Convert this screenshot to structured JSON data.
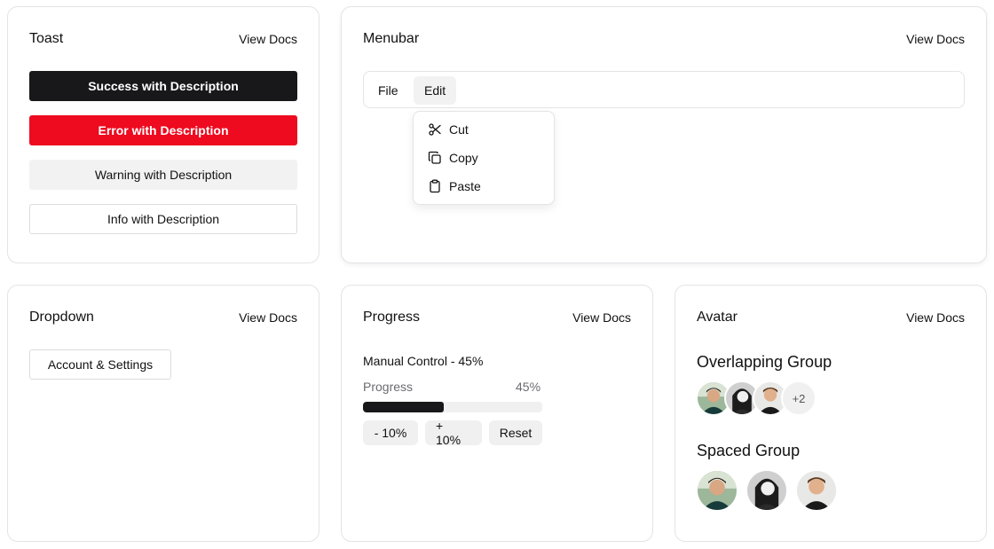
{
  "common": {
    "view_docs": "View Docs"
  },
  "toast": {
    "title": "Toast",
    "buttons": {
      "success": "Success with Description",
      "error": "Error with Description",
      "warning": "Warning with Description",
      "info": "Info with Description"
    },
    "colors": {
      "success": "#18181b",
      "error": "#ee0a1f",
      "warning": "#f2f2f2",
      "info": "#ffffff"
    }
  },
  "menubar": {
    "title": "Menubar",
    "menus": [
      "File",
      "Edit"
    ],
    "open_menu": "Edit",
    "items": [
      {
        "label": "Cut",
        "icon": "scissors-icon"
      },
      {
        "label": "Copy",
        "icon": "copy-icon"
      },
      {
        "label": "Paste",
        "icon": "clipboard-icon"
      }
    ]
  },
  "dropdown": {
    "title": "Dropdown",
    "trigger": "Account & Settings"
  },
  "progress": {
    "title": "Progress",
    "heading": "Manual Control - 45%",
    "label": "Progress",
    "value_text": "45%",
    "value": 45,
    "buttons": {
      "minus": "- 10%",
      "plus": "+ 10%",
      "reset": "Reset"
    }
  },
  "avatar": {
    "title": "Avatar",
    "overlapping_title": "Overlapping Group",
    "spaced_title": "Spaced Group",
    "more_count": "+2",
    "people": [
      "avatar-person-1",
      "avatar-person-2",
      "avatar-person-3"
    ]
  }
}
